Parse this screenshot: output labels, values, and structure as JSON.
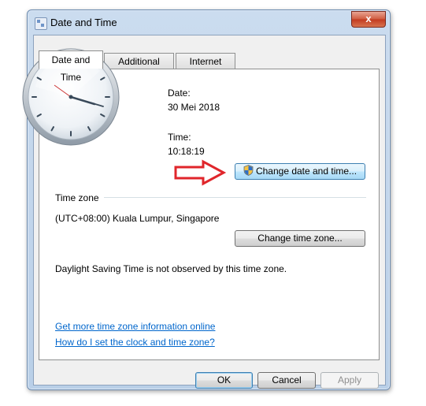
{
  "window": {
    "title": "Date and Time",
    "close_glyph": "x"
  },
  "tabs": [
    {
      "label": "Date and Time",
      "active": true
    },
    {
      "label": "Additional Clocks",
      "active": false
    },
    {
      "label": "Internet Time",
      "active": false
    }
  ],
  "date": {
    "label": "Date:",
    "value": "30 Mei 2018"
  },
  "time": {
    "label": "Time:",
    "value": "10:18:19"
  },
  "buttons": {
    "change_datetime": "Change date and time...",
    "change_timezone": "Change time zone...",
    "ok": "OK",
    "cancel": "Cancel",
    "apply": "Apply"
  },
  "timezone": {
    "group_label": "Time zone",
    "value": "(UTC+08:00) Kuala Lumpur, Singapore",
    "dst_note": "Daylight Saving Time is not observed by this time zone."
  },
  "links": {
    "more_info": "Get more time zone information online",
    "how_to": "How do I set the clock and time zone?"
  },
  "colors": {
    "arrow": "#e0262b",
    "link": "#0066cc",
    "titlebar": "#cbdcef"
  },
  "icons": {
    "window": "date-time-app-icon",
    "uac": "uac-shield-icon",
    "annotation": "red-arrow-icon"
  }
}
